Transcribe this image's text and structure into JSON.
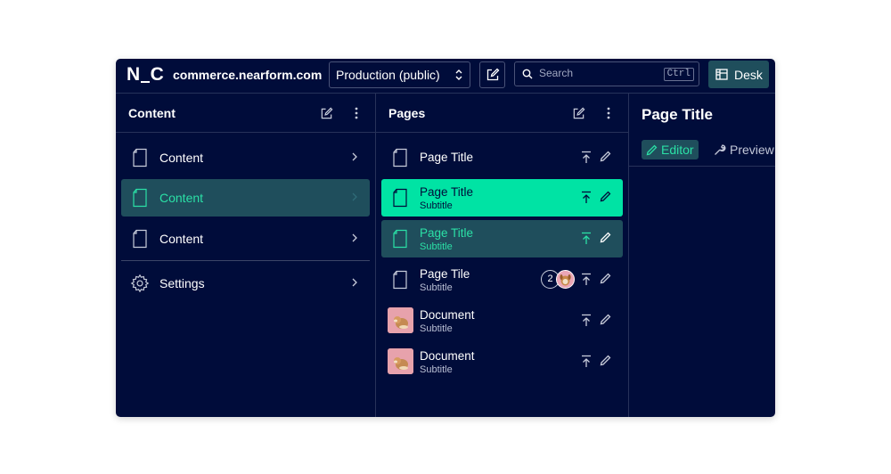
{
  "topbar": {
    "logo": "N_C",
    "domain": "commerce.nearform.com",
    "environment": {
      "selected": "Production (public)"
    },
    "search": {
      "placeholder": "Search",
      "shortcut": "Ctrl"
    },
    "desk_label": "Desk",
    "icons": {
      "edit": "compose-icon",
      "search": "search-icon",
      "desk": "desk-icon",
      "environment": "chevron-up-down-icon"
    }
  },
  "content_pane": {
    "title": "Content",
    "items": [
      {
        "label": "Content",
        "icon": "document-icon",
        "active": false
      },
      {
        "label": "Content",
        "icon": "document-icon",
        "active": true
      },
      {
        "label": "Content",
        "icon": "document-icon",
        "active": false
      },
      {
        "label": "Settings",
        "icon": "gear-icon",
        "active": false
      }
    ]
  },
  "pages_pane": {
    "title": "Pages",
    "items": [
      {
        "title": "Page Title",
        "subtitle": "",
        "state": "default",
        "media": "document-icon"
      },
      {
        "title": "Page Title",
        "subtitle": "Subtitle",
        "state": "selected",
        "media": "document-icon"
      },
      {
        "title": "Page Title",
        "subtitle": "Subtitle",
        "state": "open",
        "media": "document-icon"
      },
      {
        "title": "Page Tile",
        "subtitle": "Subtitle",
        "state": "default",
        "media": "document-icon",
        "presence_count": "2"
      },
      {
        "title": "Document",
        "subtitle": "Subtitle",
        "state": "default",
        "media": "thumbnail"
      },
      {
        "title": "Document",
        "subtitle": "Subtitle",
        "state": "default",
        "media": "thumbnail"
      }
    ]
  },
  "editor_pane": {
    "title": "Page Title",
    "tabs": [
      {
        "label": "Editor",
        "icon": "pencil-icon",
        "active": true
      },
      {
        "label": "Preview",
        "icon": "wrench-icon",
        "active": false
      }
    ]
  },
  "colors": {
    "background": "#000c3a",
    "accent": "#00e3a4",
    "accent_text": "#2be0a6",
    "active_bg": "#1f4e5c",
    "border": "#27325a"
  }
}
